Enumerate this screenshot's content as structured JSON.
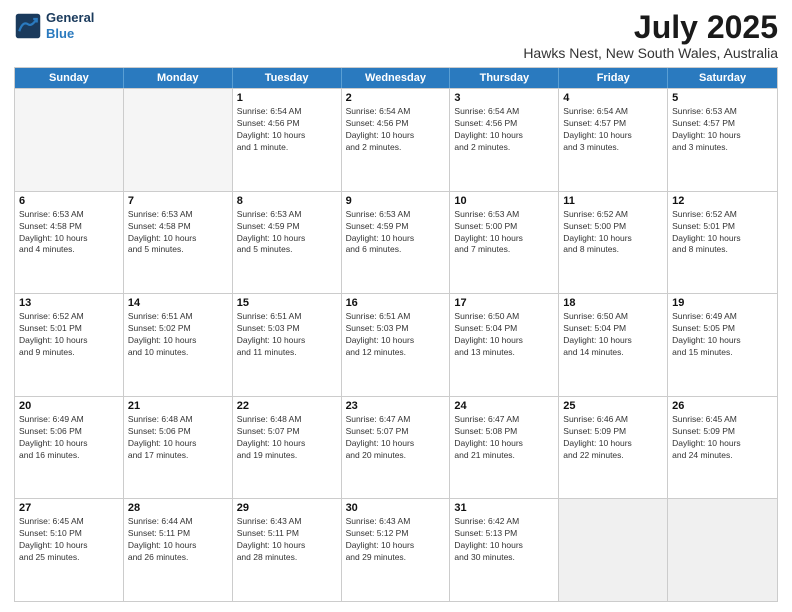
{
  "header": {
    "logo_line1": "General",
    "logo_line2": "Blue",
    "month": "July 2025",
    "location": "Hawks Nest, New South Wales, Australia"
  },
  "weekdays": [
    "Sunday",
    "Monday",
    "Tuesday",
    "Wednesday",
    "Thursday",
    "Friday",
    "Saturday"
  ],
  "weeks": [
    [
      {
        "day": "",
        "info": "",
        "empty": true
      },
      {
        "day": "",
        "info": "",
        "empty": true
      },
      {
        "day": "1",
        "info": "Sunrise: 6:54 AM\nSunset: 4:56 PM\nDaylight: 10 hours\nand 1 minute."
      },
      {
        "day": "2",
        "info": "Sunrise: 6:54 AM\nSunset: 4:56 PM\nDaylight: 10 hours\nand 2 minutes."
      },
      {
        "day": "3",
        "info": "Sunrise: 6:54 AM\nSunset: 4:56 PM\nDaylight: 10 hours\nand 2 minutes."
      },
      {
        "day": "4",
        "info": "Sunrise: 6:54 AM\nSunset: 4:57 PM\nDaylight: 10 hours\nand 3 minutes."
      },
      {
        "day": "5",
        "info": "Sunrise: 6:53 AM\nSunset: 4:57 PM\nDaylight: 10 hours\nand 3 minutes."
      }
    ],
    [
      {
        "day": "6",
        "info": "Sunrise: 6:53 AM\nSunset: 4:58 PM\nDaylight: 10 hours\nand 4 minutes."
      },
      {
        "day": "7",
        "info": "Sunrise: 6:53 AM\nSunset: 4:58 PM\nDaylight: 10 hours\nand 5 minutes."
      },
      {
        "day": "8",
        "info": "Sunrise: 6:53 AM\nSunset: 4:59 PM\nDaylight: 10 hours\nand 5 minutes."
      },
      {
        "day": "9",
        "info": "Sunrise: 6:53 AM\nSunset: 4:59 PM\nDaylight: 10 hours\nand 6 minutes."
      },
      {
        "day": "10",
        "info": "Sunrise: 6:53 AM\nSunset: 5:00 PM\nDaylight: 10 hours\nand 7 minutes."
      },
      {
        "day": "11",
        "info": "Sunrise: 6:52 AM\nSunset: 5:00 PM\nDaylight: 10 hours\nand 8 minutes."
      },
      {
        "day": "12",
        "info": "Sunrise: 6:52 AM\nSunset: 5:01 PM\nDaylight: 10 hours\nand 8 minutes."
      }
    ],
    [
      {
        "day": "13",
        "info": "Sunrise: 6:52 AM\nSunset: 5:01 PM\nDaylight: 10 hours\nand 9 minutes."
      },
      {
        "day": "14",
        "info": "Sunrise: 6:51 AM\nSunset: 5:02 PM\nDaylight: 10 hours\nand 10 minutes."
      },
      {
        "day": "15",
        "info": "Sunrise: 6:51 AM\nSunset: 5:03 PM\nDaylight: 10 hours\nand 11 minutes."
      },
      {
        "day": "16",
        "info": "Sunrise: 6:51 AM\nSunset: 5:03 PM\nDaylight: 10 hours\nand 12 minutes."
      },
      {
        "day": "17",
        "info": "Sunrise: 6:50 AM\nSunset: 5:04 PM\nDaylight: 10 hours\nand 13 minutes."
      },
      {
        "day": "18",
        "info": "Sunrise: 6:50 AM\nSunset: 5:04 PM\nDaylight: 10 hours\nand 14 minutes."
      },
      {
        "day": "19",
        "info": "Sunrise: 6:49 AM\nSunset: 5:05 PM\nDaylight: 10 hours\nand 15 minutes."
      }
    ],
    [
      {
        "day": "20",
        "info": "Sunrise: 6:49 AM\nSunset: 5:06 PM\nDaylight: 10 hours\nand 16 minutes."
      },
      {
        "day": "21",
        "info": "Sunrise: 6:48 AM\nSunset: 5:06 PM\nDaylight: 10 hours\nand 17 minutes."
      },
      {
        "day": "22",
        "info": "Sunrise: 6:48 AM\nSunset: 5:07 PM\nDaylight: 10 hours\nand 19 minutes."
      },
      {
        "day": "23",
        "info": "Sunrise: 6:47 AM\nSunset: 5:07 PM\nDaylight: 10 hours\nand 20 minutes."
      },
      {
        "day": "24",
        "info": "Sunrise: 6:47 AM\nSunset: 5:08 PM\nDaylight: 10 hours\nand 21 minutes."
      },
      {
        "day": "25",
        "info": "Sunrise: 6:46 AM\nSunset: 5:09 PM\nDaylight: 10 hours\nand 22 minutes."
      },
      {
        "day": "26",
        "info": "Sunrise: 6:45 AM\nSunset: 5:09 PM\nDaylight: 10 hours\nand 24 minutes."
      }
    ],
    [
      {
        "day": "27",
        "info": "Sunrise: 6:45 AM\nSunset: 5:10 PM\nDaylight: 10 hours\nand 25 minutes."
      },
      {
        "day": "28",
        "info": "Sunrise: 6:44 AM\nSunset: 5:11 PM\nDaylight: 10 hours\nand 26 minutes."
      },
      {
        "day": "29",
        "info": "Sunrise: 6:43 AM\nSunset: 5:11 PM\nDaylight: 10 hours\nand 28 minutes."
      },
      {
        "day": "30",
        "info": "Sunrise: 6:43 AM\nSunset: 5:12 PM\nDaylight: 10 hours\nand 29 minutes."
      },
      {
        "day": "31",
        "info": "Sunrise: 6:42 AM\nSunset: 5:13 PM\nDaylight: 10 hours\nand 30 minutes."
      },
      {
        "day": "",
        "info": "",
        "empty": true,
        "shaded": true
      },
      {
        "day": "",
        "info": "",
        "empty": true,
        "shaded": true
      }
    ]
  ]
}
